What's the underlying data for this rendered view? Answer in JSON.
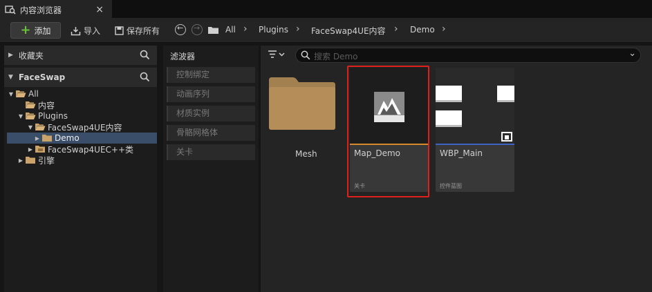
{
  "tab": {
    "title": "内容浏览器",
    "close": "×"
  },
  "toolbar": {
    "add_label": "添加",
    "import_label": "导入",
    "save_all_label": "保存所有",
    "breadcrumbs": [
      "All",
      "Plugins",
      "FaceSwap4UE内容",
      "Demo"
    ]
  },
  "left_panel": {
    "favorites_label": "收藏夹",
    "project_label": "FaceSwap",
    "tree": [
      {
        "label": "All",
        "expanded": true,
        "selected": false
      },
      {
        "label": "内容",
        "expanded": false,
        "selected": false
      },
      {
        "label": "Plugins",
        "expanded": true,
        "selected": false
      },
      {
        "label": "FaceSwap4UE内容",
        "expanded": true,
        "selected": false
      },
      {
        "label": "Demo",
        "expanded": false,
        "selected": true
      },
      {
        "label": "FaceSwap4UEC++类",
        "expanded": false,
        "selected": false
      },
      {
        "label": "引擎",
        "expanded": false,
        "selected": false
      }
    ]
  },
  "filters": {
    "title": "滤波器",
    "items": [
      "控制绑定",
      "动画序列",
      "材质实例",
      "骨骼网格体",
      "关卡"
    ]
  },
  "content": {
    "search_placeholder": "搜索 Demo",
    "folder": {
      "name": "Mesh"
    },
    "assets": [
      {
        "name": "Map_Demo",
        "type": "关卡",
        "accent": "#d68a2b",
        "highlighted": true
      },
      {
        "name": "WBP_Main",
        "type": "控件蓝图",
        "accent": "#3b63c4",
        "highlighted": false
      }
    ]
  },
  "colors": {
    "selection": "#3b4e69",
    "highlight": "#e0201b",
    "add_plus": "#6bbf3b"
  }
}
